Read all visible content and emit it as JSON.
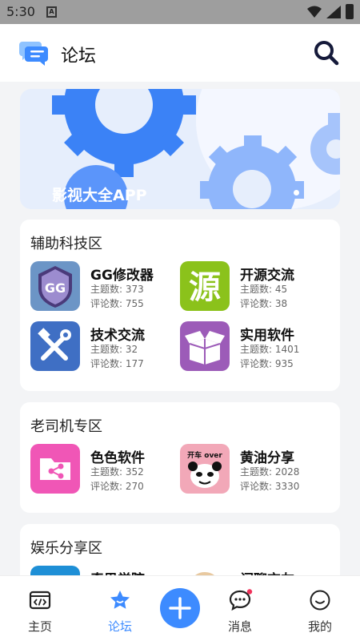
{
  "status": {
    "time": "5:30",
    "sim_label": "A"
  },
  "header": {
    "title": "论坛"
  },
  "banner": {
    "caption": "影视大全APP"
  },
  "sections": [
    {
      "title": "辅助科技区",
      "items": [
        {
          "name": "GG修改器",
          "topics": "主题数: 373",
          "comments": "评论数: 755",
          "icon_text": "GG"
        },
        {
          "name": "开源交流",
          "topics": "主题数: 45",
          "comments": "评论数: 38",
          "icon_text": "源"
        },
        {
          "name": "技术交流",
          "topics": "主题数: 32",
          "comments": "评论数: 177"
        },
        {
          "name": "实用软件",
          "topics": "主题数: 1401",
          "comments": "评论数: 935"
        }
      ]
    },
    {
      "title": "老司机专区",
      "items": [
        {
          "name": "色色软件",
          "topics": "主题数: 352",
          "comments": "评论数: 270"
        },
        {
          "name": "黄油分享",
          "topics": "主题数: 2028",
          "comments": "评论数: 3330",
          "icon_text": "开车 over"
        }
      ]
    },
    {
      "title": "娱乐分享区",
      "items": [
        {
          "name": "奇思学院"
        },
        {
          "name": "闲聊交友"
        }
      ]
    }
  ],
  "nav": [
    {
      "label": "主页",
      "icon": "code-screen-icon"
    },
    {
      "label": "论坛",
      "icon": "star-icon"
    },
    {
      "label": "消息",
      "icon": "chat-bubble-icon"
    },
    {
      "label": "我的",
      "icon": "smile-face-icon"
    }
  ],
  "colors": {
    "accent": "#3d8bff",
    "status_bar": "#9e9e9e",
    "background": "#f3f4f6"
  }
}
